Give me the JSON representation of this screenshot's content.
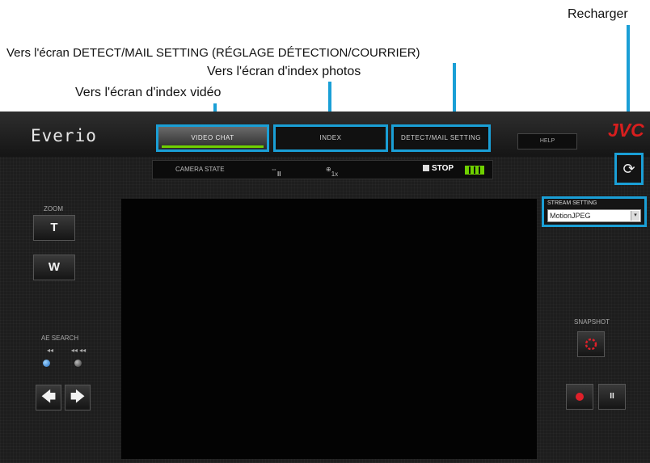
{
  "callouts": {
    "reload": "Recharger",
    "detect_mail": "Vers l'écran DETECT/MAIL SETTING (RÉGLAGE DÉTECTION/COURRIER)",
    "photo_index": "Vers l'écran d'index photos",
    "video_index": "Vers l'écran d'index vidéo"
  },
  "app": {
    "brand": "Everio",
    "logo": "JVC",
    "tabs": [
      {
        "label": "VIDEO CHAT",
        "active": true
      },
      {
        "label": "INDEX",
        "active": false
      },
      {
        "label": "DETECT/MAIL SETTING",
        "active": false
      }
    ],
    "help_label": "HELP",
    "status": {
      "camera_state": "CAMERA STATE",
      "rec_mode": "II",
      "zoom": "1x",
      "stop": "STOP"
    },
    "zoom": {
      "label": "ZOOM",
      "tele": "T",
      "wide": "W"
    },
    "pan": {
      "label": "AE SEARCH",
      "slow": "◂◂",
      "fast": "◂◂ ◂◂"
    },
    "stream": {
      "label": "STREAM SETTING",
      "value": "MotionJPEG"
    },
    "snapshot": {
      "label": "SNAPSHOT"
    },
    "icons": {
      "left_arrow": "🡄",
      "right_arrow": "🡆",
      "reload": "⟳",
      "caret": "▾",
      "pause": "II"
    },
    "colors": {
      "accent": "#1a9fd6",
      "logo_red": "#d81e1e",
      "battery_green": "#6fd000",
      "record_red": "#e0202a"
    }
  }
}
